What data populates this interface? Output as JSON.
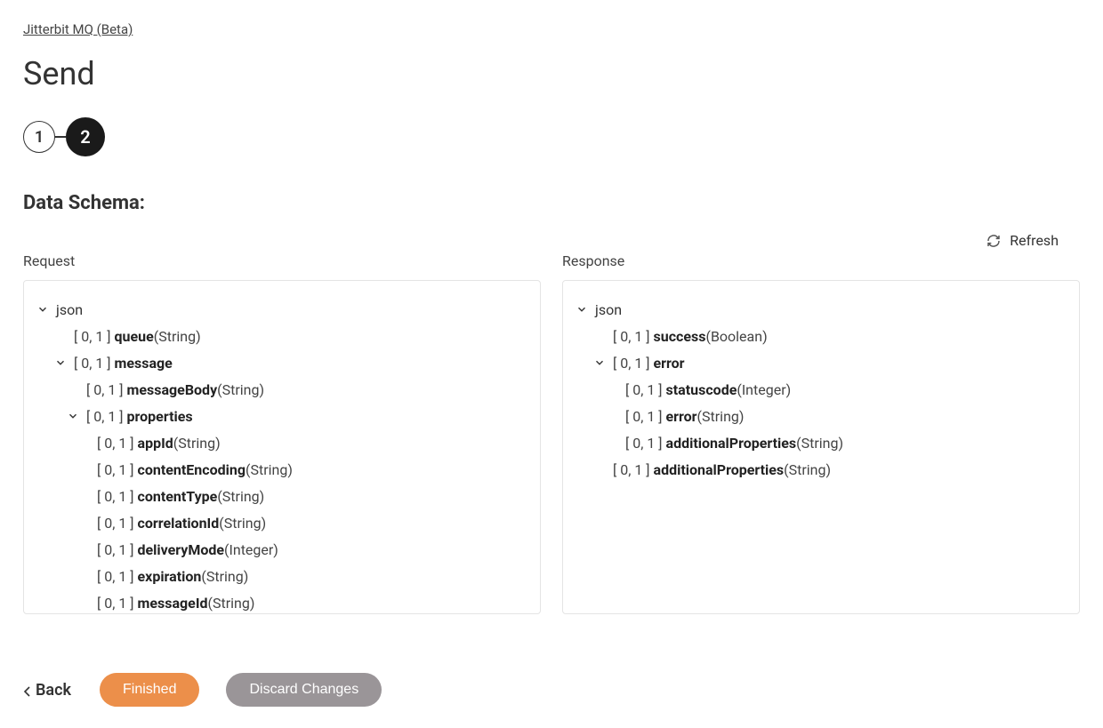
{
  "breadcrumb": {
    "label": "Jitterbit MQ (Beta)"
  },
  "page_title": "Send",
  "stepper": {
    "step1": "1",
    "step2": "2"
  },
  "section_title": "Data Schema:",
  "refresh_label": "Refresh",
  "columns": {
    "request": "Request",
    "response": "Response"
  },
  "request_tree": [
    {
      "indent": 0,
      "chevron": true,
      "card": "",
      "name": "json",
      "type": "",
      "bold": false
    },
    {
      "indent": 1,
      "chevron": false,
      "card": "[ 0, 1 ]",
      "name": "queue",
      "type": "(String)",
      "bold": true
    },
    {
      "indent": 1,
      "chevron": true,
      "card": "[ 0, 1 ]",
      "name": "message",
      "type": "",
      "bold": true
    },
    {
      "indent": 2,
      "chevron": false,
      "card": "[ 0, 1 ]",
      "name": "messageBody",
      "type": "(String)",
      "bold": true
    },
    {
      "indent": 2,
      "chevron": true,
      "card": "[ 0, 1 ]",
      "name": "properties",
      "type": "",
      "bold": true
    },
    {
      "indent": 3,
      "chevron": false,
      "card": "[ 0, 1 ]",
      "name": "appId",
      "type": "(String)",
      "bold": true
    },
    {
      "indent": 3,
      "chevron": false,
      "card": "[ 0, 1 ]",
      "name": "contentEncoding",
      "type": "(String)",
      "bold": true
    },
    {
      "indent": 3,
      "chevron": false,
      "card": "[ 0, 1 ]",
      "name": "contentType",
      "type": "(String)",
      "bold": true
    },
    {
      "indent": 3,
      "chevron": false,
      "card": "[ 0, 1 ]",
      "name": "correlationId",
      "type": "(String)",
      "bold": true
    },
    {
      "indent": 3,
      "chevron": false,
      "card": "[ 0, 1 ]",
      "name": "deliveryMode",
      "type": "(Integer)",
      "bold": true
    },
    {
      "indent": 3,
      "chevron": false,
      "card": "[ 0, 1 ]",
      "name": "expiration",
      "type": "(String)",
      "bold": true
    },
    {
      "indent": 3,
      "chevron": false,
      "card": "[ 0, 1 ]",
      "name": "messageId",
      "type": "(String)",
      "bold": true
    }
  ],
  "response_tree": [
    {
      "indent": 0,
      "chevron": true,
      "card": "",
      "name": "json",
      "type": "",
      "bold": false
    },
    {
      "indent": 1,
      "chevron": false,
      "card": "[ 0, 1 ]",
      "name": "success",
      "type": "(Boolean)",
      "bold": true
    },
    {
      "indent": 1,
      "chevron": true,
      "card": "[ 0, 1 ]",
      "name": "error",
      "type": "",
      "bold": true
    },
    {
      "indent": 2,
      "chevron": false,
      "card": "[ 0, 1 ]",
      "name": "statuscode",
      "type": "(Integer)",
      "bold": true
    },
    {
      "indent": 2,
      "chevron": false,
      "card": "[ 0, 1 ]",
      "name": "error",
      "type": "(String)",
      "bold": true
    },
    {
      "indent": 2,
      "chevron": false,
      "card": "[ 0, 1 ]",
      "name": "additionalProperties",
      "type": "(String)",
      "bold": true
    },
    {
      "indent": 1,
      "chevron": false,
      "card": "[ 0, 1 ]",
      "name": "additionalProperties",
      "type": "(String)",
      "bold": true
    }
  ],
  "footer": {
    "back": "Back",
    "finished": "Finished",
    "discard": "Discard Changes"
  }
}
